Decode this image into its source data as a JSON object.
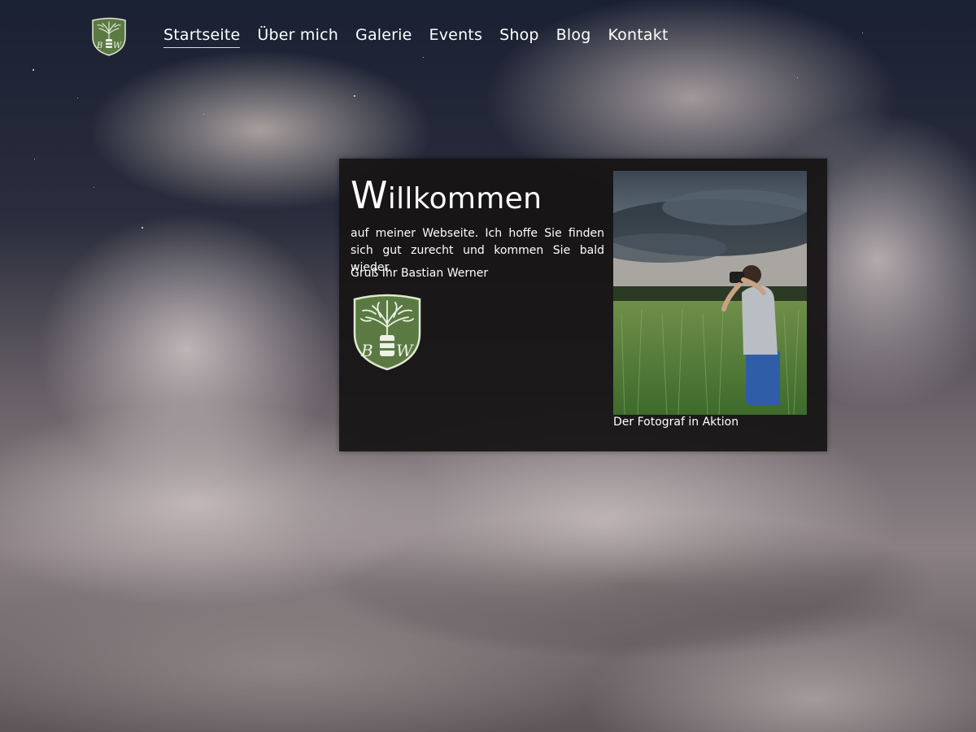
{
  "nav": {
    "items": [
      {
        "label": "Startseite",
        "active": true
      },
      {
        "label": "Über mich",
        "active": false
      },
      {
        "label": "Galerie",
        "active": false
      },
      {
        "label": "Events",
        "active": false
      },
      {
        "label": "Shop",
        "active": false
      },
      {
        "label": "Blog",
        "active": false
      },
      {
        "label": "Kontakt",
        "active": false
      }
    ]
  },
  "logo": {
    "letters": "BW",
    "color": "#5b7a43"
  },
  "welcome": {
    "title_initial": "W",
    "title_rest": "illkommen",
    "text": "auf meiner Webseite. Ich hoffe Sie finden sich gut zurecht und kommen Sie bald wieder.",
    "greeting": "Gruß Ihr Bastian Werner",
    "photo_caption": "Der Fotograf in Aktion"
  },
  "colors": {
    "panel": "#161414",
    "text": "#ffffff",
    "logo_green": "#5b7a43"
  }
}
